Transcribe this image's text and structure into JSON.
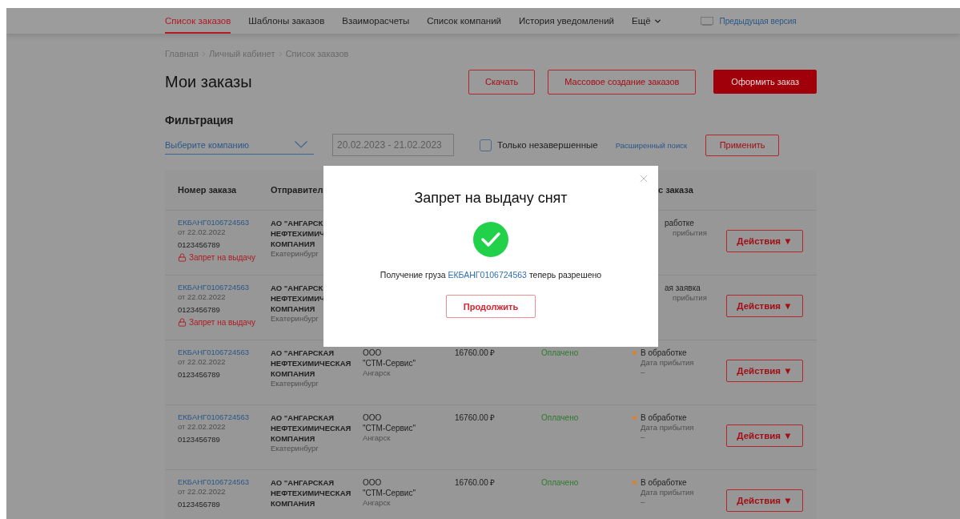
{
  "nav": {
    "tabs": [
      {
        "label": "Список заказов",
        "selected": true
      },
      {
        "label": "Шаблоны заказов",
        "selected": false
      },
      {
        "label": "Взаиморасчеты",
        "selected": false
      },
      {
        "label": "Список компаний",
        "selected": false
      },
      {
        "label": "История уведомлений",
        "selected": false
      }
    ],
    "more": "Ещё",
    "prev_version": "Предыдущая версия"
  },
  "breadcrumbs": [
    "Главная",
    "Личный кабинет",
    "Список заказов"
  ],
  "page_title": "Мои заказы",
  "actions": [
    {
      "label": "Скачать",
      "kind": "outline"
    },
    {
      "label": "Массовое создание заказов",
      "kind": "outline"
    },
    {
      "label": "Оформить заказ",
      "kind": "primary"
    }
  ],
  "filters": {
    "title": "Фильтрация",
    "company_placeholder": "Выберите компанию",
    "date_range": "20.02.2023 - 21.02.2023",
    "unfinished": {
      "label": "Только незавершенные",
      "checked": false
    },
    "advanced_link": "Расширенный поиск",
    "apply": "Применить"
  },
  "table": {
    "columns": [
      "Номер заказа",
      "Отправител",
      "с заказа"
    ],
    "rows": [
      {
        "kind": "covered",
        "number": "ЕКБАНГ0106724563",
        "date": "от 22.02.2022",
        "code": "0123456789",
        "block": "Запрет на выдачу",
        "sender": [
          "АО \"АНГАРСК",
          "НЕФТЕХИМИЧ",
          "КОМПАНИЯ"
        ],
        "sender_city": "Екатеринбург",
        "status": {
          "label": "работке"
        },
        "arrival_label": "прибытия",
        "action": "Действия ▼"
      },
      {
        "kind": "covered",
        "number": "ЕКБАНГ0106724563",
        "date": "от 22.02.2022",
        "code": "0123456789",
        "block": "Запрет на выдачу",
        "sender": [
          "АО \"АНГАРСК",
          "НЕФТЕХИМИЧ",
          "КОМПАНИЯ"
        ],
        "sender_city": "Екатеринбург",
        "status": {
          "label": "ая заявка"
        },
        "arrival_label": "прибытия",
        "action": "Действия ▼"
      },
      {
        "kind": "full",
        "number": "ЕКБАНГ0106724563",
        "date": "от 22.02.2022",
        "code": "0123456789",
        "sender": [
          "АО \"АНГАРСКАЯ",
          "НЕФТЕХИМИЧЕСКАЯ",
          "КОМПАНИЯ"
        ],
        "sender_city": "Екатеринбург",
        "recipient": [
          "ООО",
          "\"СТМ-Сервис\""
        ],
        "recipient_city": "Ангарск",
        "sum": "16760.00 ₽",
        "payment": "Оплачено",
        "status": {
          "label": "В обработке",
          "color": "#d9822b"
        },
        "arrival_label": "Дата прибытия",
        "arrival_value": "–",
        "action": "Действия ▼"
      },
      {
        "kind": "full",
        "number": "ЕКБАНГ0106724563",
        "date": "от 22.02.2022",
        "code": "0123456789",
        "sender": [
          "АО \"АНГАРСКАЯ",
          "НЕФТЕХИМИЧЕСКАЯ",
          "КОМПАНИЯ"
        ],
        "sender_city": "Екатеринбург",
        "recipient": [
          "ООО",
          "\"СТМ-Сервис\""
        ],
        "recipient_city": "Ангарск",
        "sum": "16760.00 ₽",
        "payment": "Оплачено",
        "status": {
          "label": "В обработке",
          "color": "#d9822b"
        },
        "arrival_label": "Дата прибытия",
        "arrival_value": "–",
        "action": "Действия ▼"
      },
      {
        "kind": "full",
        "number": "ЕКБАНГ0106724563",
        "date": "от 22.02.2022",
        "code": "0123456789",
        "sender": [
          "АО \"АНГАРСКАЯ",
          "НЕФТЕХИМИЧЕСКАЯ",
          "КОМПАНИЯ"
        ],
        "recipient": [
          "ООО",
          "\"СТМ-Сервис\""
        ],
        "recipient_city": "Ангарск",
        "sum": "16760.00 ₽",
        "payment": "Оплачено",
        "status": {
          "label": "В обработке",
          "color": "#d9822b"
        },
        "arrival_label": "Дата прибытия",
        "arrival_value": "–",
        "action": "Действия ▼"
      }
    ]
  },
  "modal": {
    "title": "Запрет на выдачу снят",
    "message_before": "Получение груза",
    "link": "ЕКБАНГ0106724563",
    "message_after": "теперь разрешено",
    "button": "Продолжить"
  }
}
